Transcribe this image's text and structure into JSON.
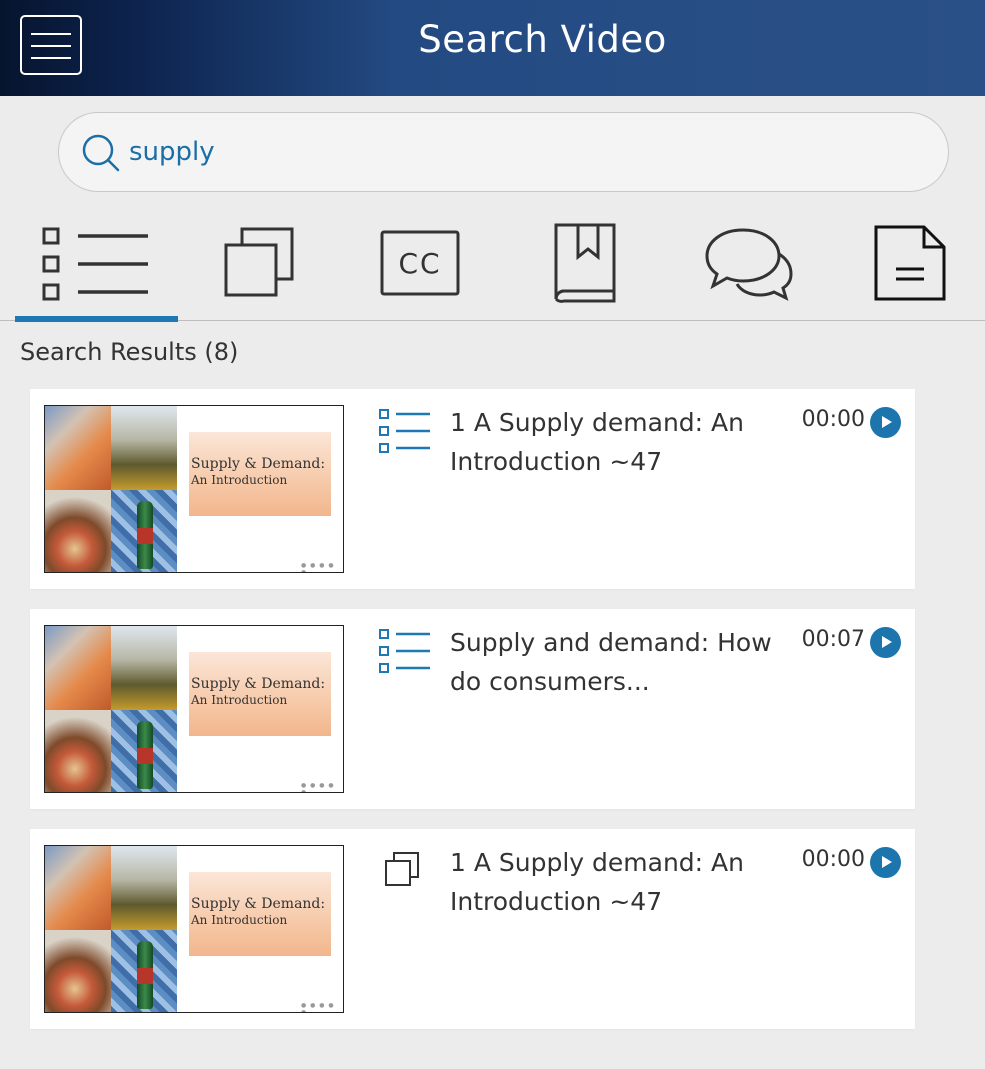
{
  "header": {
    "title": "Search Video"
  },
  "search": {
    "query": "supply"
  },
  "tabs": [
    {
      "id": "outline",
      "icon": "list-icon",
      "active": true
    },
    {
      "id": "slides",
      "icon": "stacked-squares-icon",
      "active": false
    },
    {
      "id": "captions",
      "icon": "closed-captions-icon",
      "active": false
    },
    {
      "id": "bookmarks",
      "icon": "bookmark-book-icon",
      "active": false
    },
    {
      "id": "discussion",
      "icon": "chat-bubbles-icon",
      "active": false
    },
    {
      "id": "notes",
      "icon": "document-icon",
      "active": false
    }
  ],
  "results": {
    "heading": "Search Results (8)",
    "items": [
      {
        "type_icon": "list-icon",
        "title": "1 A Supply demand: An Introduction ~47",
        "time": "00:00",
        "thumb_title": "Supply & Demand:",
        "thumb_subtitle": "An Introduction"
      },
      {
        "type_icon": "list-icon",
        "title": "Supply and demand: How do consumers...",
        "time": "00:07",
        "thumb_title": "Supply & Demand:",
        "thumb_subtitle": "An Introduction"
      },
      {
        "type_icon": "stacked-squares-icon",
        "title": "1 A Supply demand: An Introduction ~47",
        "time": "00:00",
        "thumb_title": "Supply & Demand:",
        "thumb_subtitle": "An Introduction"
      }
    ]
  },
  "colors": {
    "accent": "#1e78b4",
    "header_dark": "#06142e",
    "header_light": "#2a5187"
  }
}
